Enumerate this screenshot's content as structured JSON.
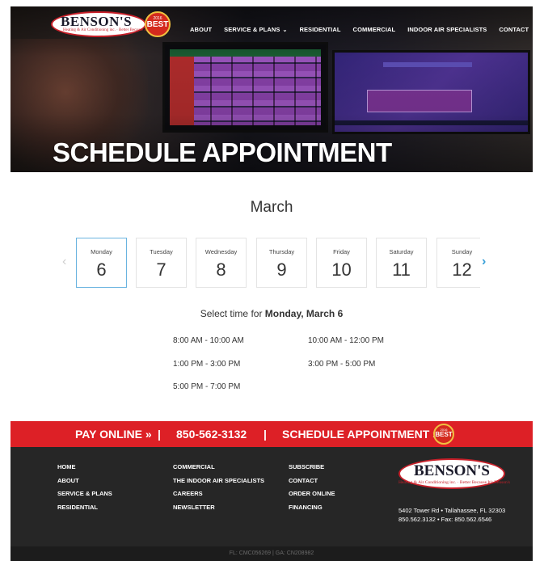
{
  "header": {
    "logo_name": "BENSON'S",
    "logo_tagline": "Heating & Air Conditioning inc. · Better Because It's Benson's",
    "badge_year": "2016",
    "badge_text": "BEST",
    "nav": [
      {
        "label": "ABOUT"
      },
      {
        "label": "SERVICE & PLANS",
        "has_dropdown": true
      },
      {
        "label": "RESIDENTIAL"
      },
      {
        "label": "COMMERCIAL"
      },
      {
        "label": "INDOOR AIR SPECIALISTS"
      },
      {
        "label": "CONTACT"
      }
    ],
    "chevron": "⌄"
  },
  "hero": {
    "title": "SCHEDULE APPOINTMENT"
  },
  "calendar": {
    "month": "March",
    "prev_arrow": "‹",
    "next_arrow": "›",
    "selected_index": 0,
    "days": [
      {
        "name": "Monday",
        "date": "6"
      },
      {
        "name": "Tuesday",
        "date": "7"
      },
      {
        "name": "Wednesday",
        "date": "8"
      },
      {
        "name": "Thursday",
        "date": "9"
      },
      {
        "name": "Friday",
        "date": "10"
      },
      {
        "name": "Saturday",
        "date": "11"
      },
      {
        "name": "Sunday",
        "date": "12"
      }
    ],
    "select_prefix": "Select time for ",
    "select_day": "Monday, March 6",
    "slots": [
      "8:00 AM  -  10:00 AM",
      "10:00 AM  -  12:00 PM",
      "1:00 PM  -  3:00 PM",
      "3:00 PM  -  5:00 PM",
      "5:00 PM  -  7:00 PM"
    ]
  },
  "red_bar": {
    "pay_online": "PAY ONLINE »",
    "separator": "|",
    "phone": "850-562-3132",
    "schedule": "SCHEDULE APPOINTMENT »",
    "badge_year": "2016",
    "badge_text": "BEST"
  },
  "footer": {
    "col1": [
      "HOME",
      "ABOUT",
      "SERVICE & PLANS",
      "RESIDENTIAL"
    ],
    "col2": [
      "COMMERCIAL",
      "THE INDOOR AIR SPECIALISTS",
      "CAREERS",
      "NEWSLETTER"
    ],
    "col3": [
      "SUBSCRIBE",
      "CONTACT",
      "ORDER ONLINE",
      "FINANCING"
    ],
    "logo_name": "BENSON'S",
    "logo_tagline": "Heating & Air Conditioning inc. · Better Because It's Benson's",
    "address": "5402 Tower Rd • Tallahassee, FL 32303",
    "phone_fax": "850.562.3132 • Fax: 850.562.6546",
    "license": "FL: CMC056269 | GA: CN208982"
  },
  "colors": {
    "brand_red": "#dd2026",
    "selected_border": "#6ab4e0",
    "footer_bg": "#262626"
  }
}
